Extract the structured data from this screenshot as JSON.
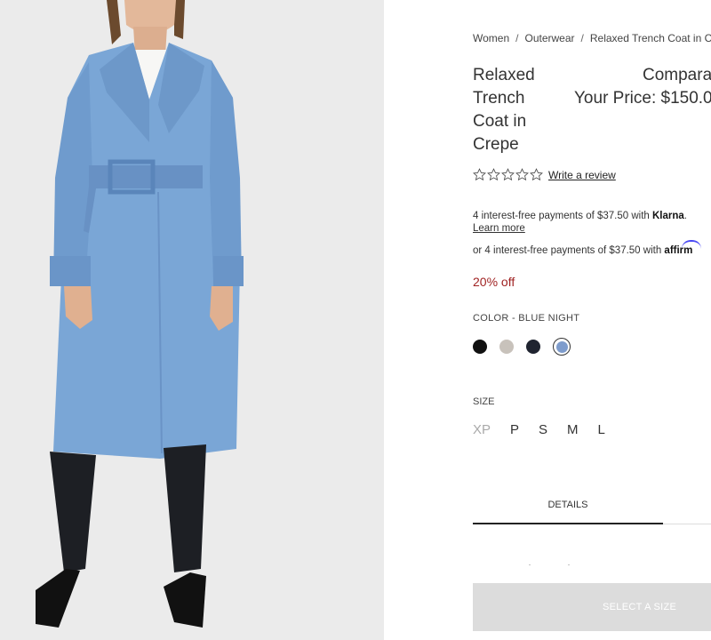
{
  "breadcrumb": [
    {
      "label": "Women"
    },
    {
      "label": "Outerwear"
    },
    {
      "label": "Relaxed Trench Coat in C"
    }
  ],
  "product": {
    "title": "Relaxed Trench Coat in Crepe",
    "compare_label": "Compara",
    "your_price": "Your Price: $150.0"
  },
  "rating": {
    "stars_filled": 0,
    "stars_total": 5,
    "review_link": "Write a review"
  },
  "klarna": {
    "text": "4 interest-free payments of $37.50 with ",
    "brand": "Klarna",
    "suffix": ".",
    "learn_more": "Learn more"
  },
  "affirm": {
    "text": "or 4 interest-free payments of $37.50 with ",
    "brand": "affirm"
  },
  "discount": "20% off",
  "color": {
    "label": "COLOR - BLUE NIGHT",
    "swatches": [
      {
        "hex": "#111111"
      },
      {
        "hex": "#c8c2bb"
      },
      {
        "hex": "#1f2430"
      },
      {
        "hex": "#7e9ccc",
        "selected": true
      }
    ]
  },
  "size": {
    "label": "SIZE",
    "options": [
      {
        "label": "XP",
        "available": false
      },
      {
        "label": "P",
        "available": true
      },
      {
        "label": "S",
        "available": true
      },
      {
        "label": "M",
        "available": true
      },
      {
        "label": "L",
        "available": true
      }
    ]
  },
  "tabs": {
    "details": "DETAILS"
  },
  "select_button": "SELECT A SIZE",
  "colors": {
    "discount": "#a02323",
    "coat": "#7aa6d6",
    "background": "#ebebeb"
  }
}
